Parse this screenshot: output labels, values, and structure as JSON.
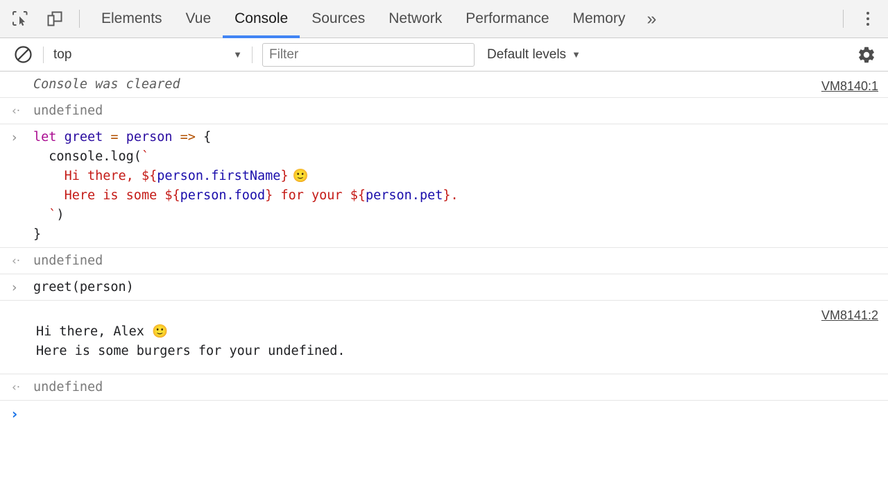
{
  "tabbar": {
    "inspect_icon": "inspect-element-icon",
    "device_icon": "device-toolbar-icon",
    "tabs": [
      {
        "label": "Elements",
        "active": false
      },
      {
        "label": "Vue",
        "active": false
      },
      {
        "label": "Console",
        "active": true
      },
      {
        "label": "Sources",
        "active": false
      },
      {
        "label": "Network",
        "active": false
      },
      {
        "label": "Performance",
        "active": false
      },
      {
        "label": "Memory",
        "active": false
      }
    ],
    "more_tabs_label": "»",
    "kebab_label": "more-options",
    "active_tab_underline_color": "#4285f4"
  },
  "toolbar": {
    "clear_icon": "clear-console-icon",
    "context": "top",
    "context_caret": "▼",
    "filter_placeholder": "Filter",
    "filter_value": "",
    "levels": "Default levels",
    "levels_caret": "▼",
    "settings_icon": "gear-icon"
  },
  "console": {
    "messages": [
      {
        "kind": "system",
        "gutter": "",
        "text": "Console was cleared",
        "link": "VM8140:1"
      },
      {
        "kind": "result",
        "gutter": "‹·",
        "text": "undefined",
        "link": ""
      },
      {
        "kind": "input-code",
        "gutter": "›",
        "link": "",
        "lines": [
          [
            {
              "t": "let",
              "c": "tok-kw"
            },
            {
              "t": " ",
              "c": "tok-punct"
            },
            {
              "t": "greet",
              "c": "tok-ident"
            },
            {
              "t": " ",
              "c": "tok-punct"
            },
            {
              "t": "=",
              "c": "tok-op"
            },
            {
              "t": " ",
              "c": "tok-punct"
            },
            {
              "t": "person",
              "c": "tok-ident"
            },
            {
              "t": " ",
              "c": "tok-punct"
            },
            {
              "t": "=>",
              "c": "tok-op"
            },
            {
              "t": " {",
              "c": "tok-punct"
            }
          ],
          [
            {
              "t": "  console.log(",
              "c": "tok-def"
            },
            {
              "t": "`",
              "c": "tok-str"
            }
          ],
          [
            {
              "t": "    ",
              "c": "tok-def"
            },
            {
              "t": "Hi there, ",
              "c": "tok-str"
            },
            {
              "t": "${",
              "c": "tok-str"
            },
            {
              "t": "person.firstName",
              "c": "tok-subst"
            },
            {
              "t": "}",
              "c": "tok-str"
            },
            {
              "t": " 🙂",
              "c": "emoji"
            }
          ],
          [
            {
              "t": "    ",
              "c": "tok-def"
            },
            {
              "t": "Here is some ",
              "c": "tok-str"
            },
            {
              "t": "${",
              "c": "tok-str"
            },
            {
              "t": "person.food",
              "c": "tok-subst"
            },
            {
              "t": "}",
              "c": "tok-str"
            },
            {
              "t": " for your ",
              "c": "tok-str"
            },
            {
              "t": "${",
              "c": "tok-str"
            },
            {
              "t": "person.pet",
              "c": "tok-subst"
            },
            {
              "t": "}.",
              "c": "tok-str"
            }
          ],
          [
            {
              "t": "  ",
              "c": "tok-def"
            },
            {
              "t": "`",
              "c": "tok-str"
            },
            {
              "t": ")",
              "c": "tok-def"
            }
          ],
          [
            {
              "t": "}",
              "c": "tok-def"
            }
          ]
        ]
      },
      {
        "kind": "result",
        "gutter": "‹·",
        "text": "undefined",
        "link": ""
      },
      {
        "kind": "input",
        "gutter": "›",
        "text": "greet(person)",
        "link": ""
      },
      {
        "kind": "log",
        "gutter": "",
        "link": "VM8141:2",
        "lines": [
          "",
          "Hi there, Alex 🙂",
          "Here is some burgers for your undefined."
        ]
      },
      {
        "kind": "result",
        "gutter": "‹·",
        "text": "undefined",
        "link": ""
      },
      {
        "kind": "prompt",
        "gutter": "›",
        "text": "",
        "link": ""
      }
    ]
  },
  "colors": {
    "accent": "#4285f4",
    "prompt_arrow": "#1a73e8",
    "string": "#c41a16",
    "keyword": "#aa0d91",
    "identifier": "#2a0ca0",
    "operator": "#b35000",
    "substitution": "#1a0dab"
  }
}
